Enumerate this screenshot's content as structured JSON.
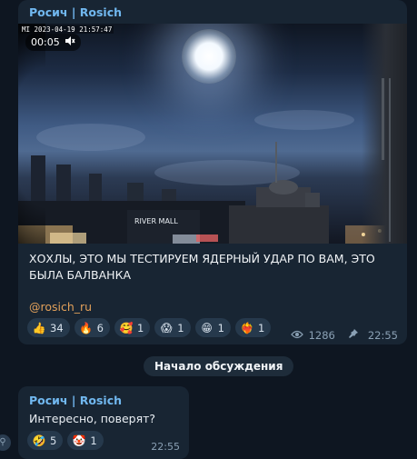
{
  "channel_post": {
    "sender": "Росич | Rosich",
    "video": {
      "timestamp": "2023-04-19 21:57:47",
      "watermark": "MI",
      "duration": "00:05",
      "sign_text": "RIVER MALL",
      "muted_icon": "speaker-muted-icon"
    },
    "caption": "ХОХЛЫ, ЭТО МЫ ТЕСТИРУЕМ ЯДЕРНЫЙ УДАР ПО ВАМ, ЭТО БЫЛА БАЛВАНКА",
    "handle": "@rosich_ru",
    "reactions": [
      {
        "emoji": "👍",
        "icon": "thumbs-up-icon",
        "count": "34"
      },
      {
        "emoji": "🔥",
        "icon": "fire-icon",
        "count": "6"
      },
      {
        "emoji": "🥰",
        "icon": "smiling-hearts-icon",
        "count": "1"
      },
      {
        "emoji": "😱",
        "icon": "screaming-face-icon",
        "count": "1"
      },
      {
        "emoji": "😁",
        "icon": "grinning-face-icon",
        "count": "1"
      },
      {
        "emoji": "❤️‍🔥",
        "icon": "heart-on-fire-icon",
        "count": "1"
      }
    ],
    "views": "1286",
    "time": "22:55"
  },
  "service_message": "Начало обсуждения",
  "reply": {
    "sender": "Росич | Rosich",
    "text": "Интересно, поверят?",
    "reactions": [
      {
        "emoji": "🤣",
        "icon": "rolling-laughing-icon",
        "count": "5"
      },
      {
        "emoji": "🤡",
        "icon": "clown-face-icon",
        "count": "1"
      }
    ],
    "time": "22:55"
  },
  "colors": {
    "background": "#0e1621",
    "bubble": "#182533",
    "sender_name": "#71b8f0",
    "handle": "#e1a05a",
    "reaction_pill": "#26394c",
    "meta": "#8aa0b4"
  }
}
